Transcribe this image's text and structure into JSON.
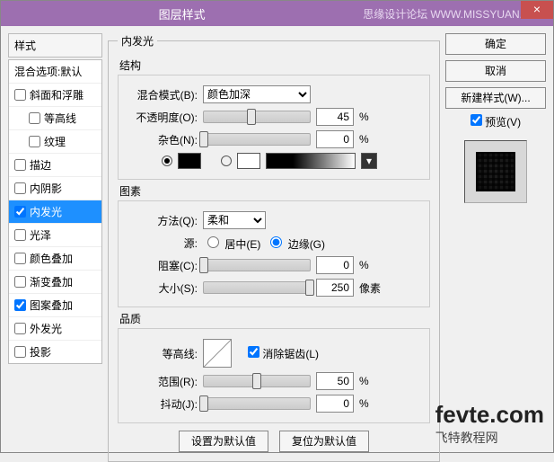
{
  "window": {
    "title": "图层样式",
    "subtitle": "思缘设计论坛",
    "subtitle_url": "WWW.MISSYUAN.COM",
    "close": "×"
  },
  "left": {
    "header": "样式",
    "blend_default": "混合选项:默认",
    "items": [
      {
        "label": "斜面和浮雕",
        "checked": false,
        "indent": false
      },
      {
        "label": "等高线",
        "checked": false,
        "indent": true
      },
      {
        "label": "纹理",
        "checked": false,
        "indent": true
      },
      {
        "label": "描边",
        "checked": false,
        "indent": false
      },
      {
        "label": "内阴影",
        "checked": false,
        "indent": false
      },
      {
        "label": "内发光",
        "checked": true,
        "indent": false,
        "selected": true
      },
      {
        "label": "光泽",
        "checked": false,
        "indent": false
      },
      {
        "label": "颜色叠加",
        "checked": false,
        "indent": false
      },
      {
        "label": "渐变叠加",
        "checked": false,
        "indent": false
      },
      {
        "label": "图案叠加",
        "checked": true,
        "indent": false
      },
      {
        "label": "外发光",
        "checked": false,
        "indent": false
      },
      {
        "label": "投影",
        "checked": false,
        "indent": false
      }
    ]
  },
  "panel": {
    "title": "内发光",
    "structure": {
      "legend": "结构",
      "blend_mode_label": "混合模式(B):",
      "blend_mode_value": "颜色加深",
      "opacity_label": "不透明度(O):",
      "opacity_value": "45",
      "opacity_pct": 45,
      "noise_label": "杂色(N):",
      "noise_value": "0",
      "noise_pct": 0,
      "percent": "%",
      "color_mode": "gradient"
    },
    "elements": {
      "legend": "图素",
      "technique_label": "方法(Q):",
      "technique_value": "柔和",
      "source_label": "源:",
      "source_center": "居中(E)",
      "source_edge": "边缘(G)",
      "source_value": "edge",
      "choke_label": "阻塞(C):",
      "choke_value": "0",
      "choke_pct": 0,
      "size_label": "大小(S):",
      "size_value": "250",
      "size_pct": 100,
      "size_unit": "像素",
      "percent": "%"
    },
    "quality": {
      "legend": "品质",
      "contour_label": "等高线:",
      "antialias_label": "消除锯齿(L)",
      "antialias_checked": true,
      "range_label": "范围(R):",
      "range_value": "50",
      "range_pct": 50,
      "jitter_label": "抖动(J):",
      "jitter_value": "0",
      "jitter_pct": 0,
      "percent": "%"
    },
    "footer": {
      "set_default": "设置为默认值",
      "reset_default": "复位为默认值"
    }
  },
  "right": {
    "ok": "确定",
    "cancel": "取消",
    "new_style": "新建样式(W)...",
    "preview_label": "预览(V)",
    "preview_checked": true
  },
  "watermark": {
    "big": "fevte.com",
    "cn": "飞特教程网"
  }
}
